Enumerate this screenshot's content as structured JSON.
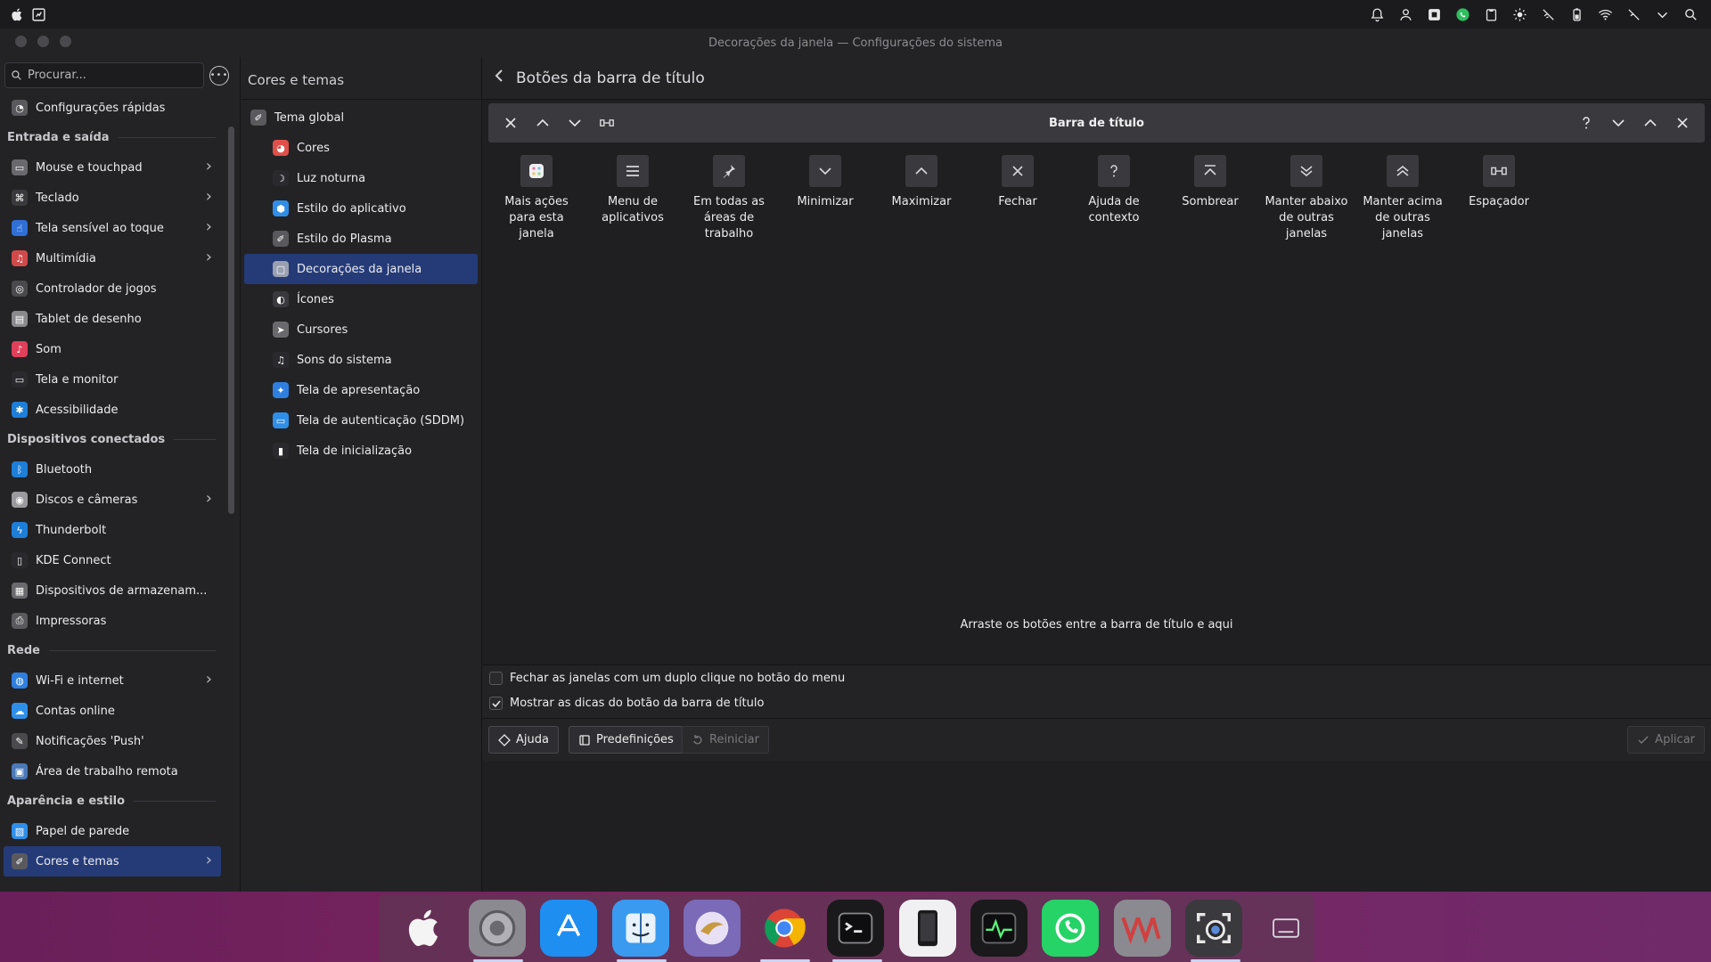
{
  "window": {
    "title": "Decorações da janela — Configurações do sistema"
  },
  "sidebar": {
    "search_placeholder": "Procurar...",
    "items": [
      {
        "type": "item",
        "label": "Configurações rápidas",
        "icon": "speedometer-icon",
        "color": "#5a5a5e"
      },
      {
        "type": "header",
        "label": "Entrada e saída"
      },
      {
        "type": "item",
        "label": "Mouse e touchpad",
        "icon": "mouse-icon",
        "color": "#6a6a6e",
        "chevron": true
      },
      {
        "type": "item",
        "label": "Teclado",
        "icon": "keyboard-icon",
        "color": "#3a3a3e",
        "chevron": true
      },
      {
        "type": "item",
        "label": "Tela sensível ao toque",
        "icon": "touchscreen-icon",
        "color": "#2f6fd6",
        "chevron": true
      },
      {
        "type": "item",
        "label": "Multimídia",
        "icon": "multimedia-icon",
        "color": "#d14a4a",
        "chevron": true
      },
      {
        "type": "item",
        "label": "Controlador de jogos",
        "icon": "gamepad-icon",
        "color": "#4a4a4e"
      },
      {
        "type": "item",
        "label": "Tablet de desenho",
        "icon": "tablet-icon",
        "color": "#8a8a8e"
      },
      {
        "type": "item",
        "label": "Som",
        "icon": "sound-icon",
        "color": "#e0405a"
      },
      {
        "type": "item",
        "label": "Tela e monitor",
        "icon": "monitor-icon",
        "color": "#2a2a2e"
      },
      {
        "type": "item",
        "label": "Acessibilidade",
        "icon": "accessibility-icon",
        "color": "#1e7fd8"
      },
      {
        "type": "header",
        "label": "Dispositivos conectados"
      },
      {
        "type": "item",
        "label": "Bluetooth",
        "icon": "bluetooth-icon",
        "color": "#1e7fd8"
      },
      {
        "type": "item",
        "label": "Discos e câmeras",
        "icon": "disk-icon",
        "color": "#9a9a9e",
        "chevron": true
      },
      {
        "type": "item",
        "label": "Thunderbolt",
        "icon": "thunderbolt-icon",
        "color": "#1e7fd8"
      },
      {
        "type": "item",
        "label": "KDE Connect",
        "icon": "phone-icon",
        "color": "#2a2a2e"
      },
      {
        "type": "item",
        "label": "Dispositivos de armazenam...",
        "icon": "storage-icon",
        "color": "#6a6a6e"
      },
      {
        "type": "item",
        "label": "Impressoras",
        "icon": "printer-icon",
        "color": "#5a5a5e"
      },
      {
        "type": "header",
        "label": "Rede"
      },
      {
        "type": "item",
        "label": "Wi-Fi e internet",
        "icon": "wifi-globe-icon",
        "color": "#2f7fe0",
        "chevron": true
      },
      {
        "type": "item",
        "label": "Contas online",
        "icon": "cloud-icon",
        "color": "#2f8fe8"
      },
      {
        "type": "item",
        "label": "Notificações 'Push'",
        "icon": "push-icon",
        "color": "#4a4a4e"
      },
      {
        "type": "item",
        "label": "Área de trabalho remota",
        "icon": "remote-desktop-icon",
        "color": "#4a7ab8"
      },
      {
        "type": "header",
        "label": "Aparência e estilo"
      },
      {
        "type": "item",
        "label": "Papel de parede",
        "icon": "wallpaper-icon",
        "color": "#2f8fe8"
      },
      {
        "type": "item",
        "label": "Cores e temas",
        "icon": "brush-icon",
        "color": "#5a5a5e",
        "chevron": true,
        "active": true
      }
    ]
  },
  "midcol": {
    "header": "Cores e temas",
    "items": [
      {
        "label": "Tema global",
        "level": 0,
        "icon": "global-theme-icon",
        "color": "#5a5a5e"
      },
      {
        "label": "Cores",
        "level": 1,
        "icon": "colors-icon",
        "color": "#e0504a"
      },
      {
        "label": "Luz noturna",
        "level": 1,
        "icon": "night-light-icon",
        "color": "#2a2a2e"
      },
      {
        "label": "Estilo do aplicativo",
        "level": 1,
        "icon": "app-style-icon",
        "color": "#2f8fe8"
      },
      {
        "label": "Estilo do Plasma",
        "level": 1,
        "icon": "plasma-style-icon",
        "color": "#5a5a5e"
      },
      {
        "label": "Decorações da janela",
        "level": 1,
        "icon": "window-decoration-icon",
        "color": "#9aa0b0",
        "active": true
      },
      {
        "label": "Ícones",
        "level": 1,
        "icon": "icons-icon",
        "color": "#3a3a3e"
      },
      {
        "label": "Cursores",
        "level": 1,
        "icon": "cursor-icon",
        "color": "#6a6a6e"
      },
      {
        "label": "Sons do sistema",
        "level": 1,
        "icon": "music-note-icon",
        "color": "#2a2a2e"
      },
      {
        "label": "Tela de apresentação",
        "level": 1,
        "icon": "splash-icon",
        "color": "#2f7fe0"
      },
      {
        "label": "Tela de autenticação (SDDM)",
        "level": 1,
        "icon": "login-screen-icon",
        "color": "#2f8fe8"
      },
      {
        "label": "Tela de inicialização",
        "level": 1,
        "icon": "boot-screen-icon",
        "color": "#2a2a2e"
      }
    ]
  },
  "main": {
    "header": "Botões da barra de título",
    "preview_title": "Barra de título",
    "palette": [
      {
        "label": "Mais ações para esta janela",
        "icon": "more-actions-icon"
      },
      {
        "label": "Menu de aplicativos",
        "icon": "hamburger-menu-icon"
      },
      {
        "label": "Em todas as áreas de trabalho",
        "icon": "pin-icon"
      },
      {
        "label": "Minimizar",
        "icon": "minimize-icon"
      },
      {
        "label": "Maximizar",
        "icon": "maximize-icon"
      },
      {
        "label": "Fechar",
        "icon": "close-icon"
      },
      {
        "label": "Ajuda de contexto",
        "icon": "help-icon"
      },
      {
        "label": "Sombrear",
        "icon": "shade-icon"
      },
      {
        "label": "Manter abaixo de outras janelas",
        "icon": "keep-below-icon"
      },
      {
        "label": "Manter acima de outras janelas",
        "icon": "keep-above-icon"
      },
      {
        "label": "Espaçador",
        "icon": "spacer-icon"
      }
    ],
    "drag_hint": "Arraste os botões entre a barra de título e aqui",
    "options": {
      "close_double_click": {
        "label": "Fechar as janelas com um duplo clique no botão do menu",
        "checked": false
      },
      "show_tooltips": {
        "label": "Mostrar as dicas do botão da barra de título",
        "checked": true
      }
    },
    "footer": {
      "help": "Ajuda",
      "presets": "Predefinições",
      "reset": "Reiniciar",
      "apply": "Aplicar"
    }
  },
  "dock": {
    "apps": [
      {
        "name": "apple-icon",
        "running": false
      },
      {
        "name": "system-settings-icon",
        "running": true
      },
      {
        "name": "app-store-icon",
        "running": false
      },
      {
        "name": "finder-icon",
        "running": true
      },
      {
        "name": "eagle-browser-icon",
        "running": false
      },
      {
        "name": "chrome-icon",
        "running": true
      },
      {
        "name": "terminal-icon",
        "running": true
      },
      {
        "name": "phone-mirror-icon",
        "running": false
      },
      {
        "name": "activity-monitor-icon",
        "running": false
      },
      {
        "name": "whatsapp-icon",
        "running": false
      },
      {
        "name": "vm-icon",
        "running": false
      },
      {
        "name": "screenshot-icon",
        "running": true
      },
      {
        "name": "keyboard-overlay-icon",
        "running": false
      }
    ]
  }
}
